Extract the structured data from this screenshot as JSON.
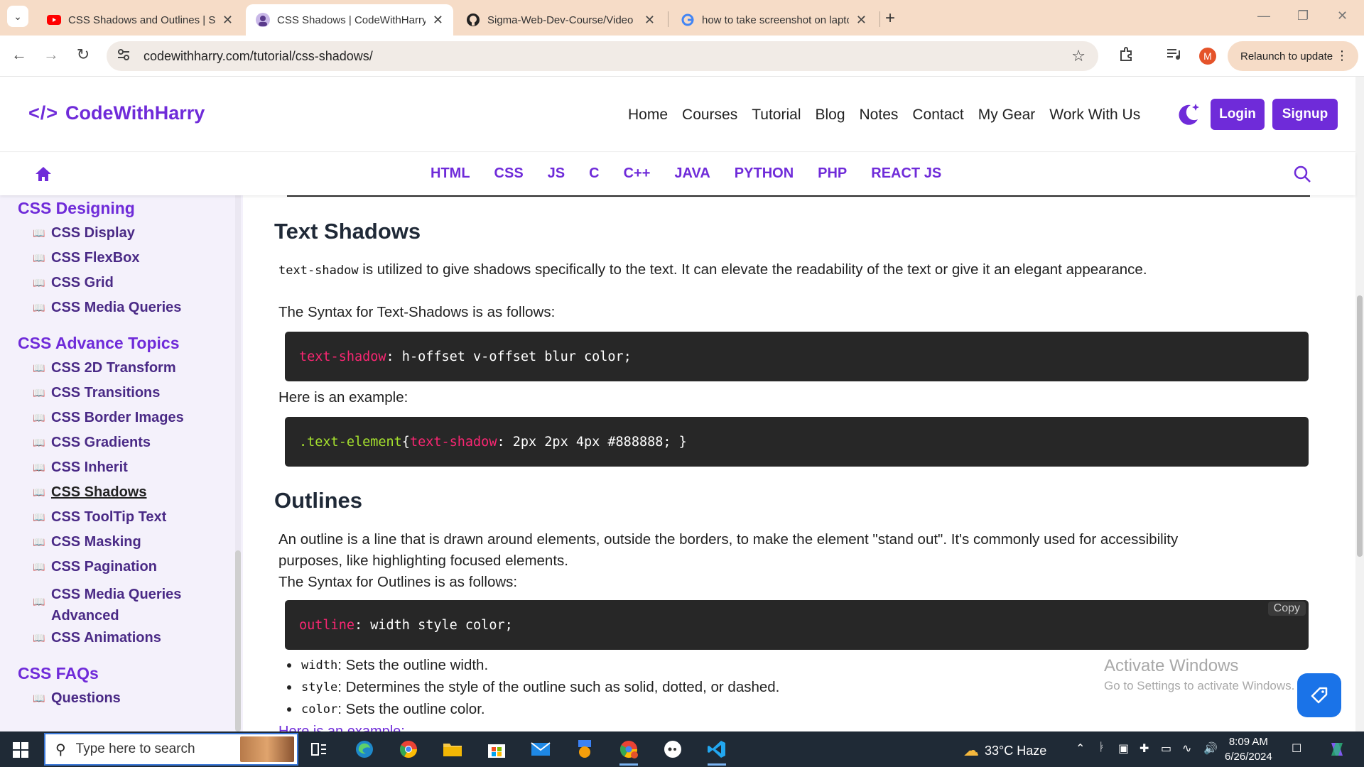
{
  "browser": {
    "tabs": [
      {
        "title": "CSS Shadows and Outlines | Sig",
        "active": false
      },
      {
        "title": "CSS Shadows | CodeWithHarry",
        "active": true
      },
      {
        "title": "Sigma-Web-Dev-Course/Video",
        "active": false
      },
      {
        "title": "how to take screenshot on lapto",
        "active": false
      }
    ],
    "url": "codewithharry.com/tutorial/css-shadows/",
    "relaunch_label": "Relaunch to update",
    "profile_initial": "M"
  },
  "site": {
    "logo_mark": "</>",
    "logo_text": "CodeWithHarry",
    "nav": [
      "Home",
      "Courses",
      "Tutorial",
      "Blog",
      "Notes",
      "Contact",
      "My Gear",
      "Work With Us"
    ],
    "login_label": "Login",
    "signup_label": "Signup",
    "languages": [
      "HTML",
      "CSS",
      "JS",
      "C",
      "C++",
      "JAVA",
      "PYTHON",
      "PHP",
      "REACT JS"
    ]
  },
  "sidebar": {
    "sections": [
      {
        "heading": "CSS Designing",
        "items": [
          "CSS Display",
          "CSS FlexBox",
          "CSS Grid",
          "CSS Media Queries"
        ]
      },
      {
        "heading": "CSS Advance Topics",
        "items": [
          "CSS 2D Transform",
          "CSS Transitions",
          "CSS Border Images",
          "CSS Gradients",
          "CSS Inherit",
          "CSS Shadows",
          "CSS ToolTip Text",
          "CSS Masking",
          "CSS Pagination",
          "CSS Media Queries Advanced",
          "CSS Animations"
        ]
      },
      {
        "heading": "CSS FAQs",
        "items": [
          "Questions"
        ]
      }
    ],
    "current_item": "CSS Shadows"
  },
  "content": {
    "text_shadows": {
      "heading": "Text Shadows",
      "intro_code": "text-shadow",
      "intro_rest": " is utilized to give shadows specifically to the text. It can elevate the readability of the text or give it an elegant appearance.",
      "syntax_label": "The Syntax for Text-Shadows is as follows:",
      "syntax_prop": "text-shadow",
      "syntax_rest": ": h-offset v-offset blur color;",
      "example_label": "Here is an example:",
      "example_selector": ".text-element",
      "example_open": " { ",
      "example_prop": "text-shadow",
      "example_rest": ": 2px 2px 4px #888888; }"
    },
    "outlines": {
      "heading": "Outlines",
      "intro_line1": "An outline is a line that is drawn around elements, outside the borders, to make the element \"stand out\". It's commonly used for accessibility",
      "intro_line2": "purposes, like highlighting focused elements.",
      "syntax_label": "The Syntax for Outlines is as follows:",
      "syntax_prop": "outline",
      "syntax_rest": ": width style color;",
      "copy_label": "Copy",
      "bullets": [
        {
          "code": "width",
          "text": ": Sets the outline width."
        },
        {
          "code": "style",
          "text": ": Determines the style of the outline such as solid, dotted, or dashed."
        },
        {
          "code": "color",
          "text": ": Sets the outline color."
        }
      ],
      "partial_next": "Here is an example:"
    }
  },
  "activation": {
    "title": "Activate Windows",
    "subtitle": "Go to Settings to activate Windows."
  },
  "taskbar": {
    "search_placeholder": "Type here to search",
    "weather": "33°C  Haze",
    "time": "8:09 AM",
    "date": "6/26/2024"
  },
  "colors": {
    "brand_purple": "#6f2bd9",
    "tab_strip": "#f6dcc7",
    "code_bg": "#272727",
    "code_keyword": "#f92672",
    "code_selector": "#a6e22e"
  }
}
